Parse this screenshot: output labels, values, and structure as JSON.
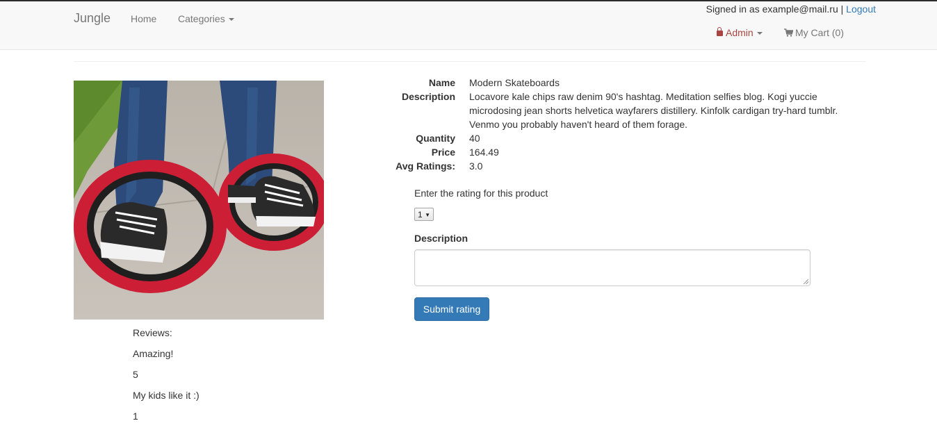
{
  "navbar": {
    "brand": "Jungle",
    "home": "Home",
    "categories": "Categories",
    "signed_in_text": "Signed in as example@mail.ru",
    "separator": "|",
    "logout": "Logout",
    "admin": "Admin",
    "cart": "My Cart (0)"
  },
  "product": {
    "image_alt": "Modern Skateboards",
    "labels": {
      "name": "Name",
      "description": "Description",
      "quantity": "Quantity",
      "price": "Price",
      "avg_ratings": "Avg Ratings:"
    },
    "name": "Modern Skateboards",
    "description": "Locavore kale chips raw denim 90's hashtag. Meditation selfies blog. Kogi yuccie microdosing jean shorts helvetica wayfarers distillery. Kinfolk cardigan try-hard tumblr. Venmo you probably haven't heard of them forage.",
    "quantity": "40",
    "price": "164.49",
    "avg_ratings": "3.0"
  },
  "rating_form": {
    "prompt": "Enter the rating for this product",
    "selected": "1",
    "description_label": "Description",
    "description_value": "",
    "submit": "Submit rating"
  },
  "reviews": {
    "title": "Reviews:",
    "items": [
      {
        "text": "Amazing!",
        "rating": "5"
      },
      {
        "text": "My kids like it :)",
        "rating": "1"
      }
    ]
  },
  "colors": {
    "primary": "#337ab7",
    "admin": "#a94442",
    "navbar_bg": "#f8f8f8"
  }
}
